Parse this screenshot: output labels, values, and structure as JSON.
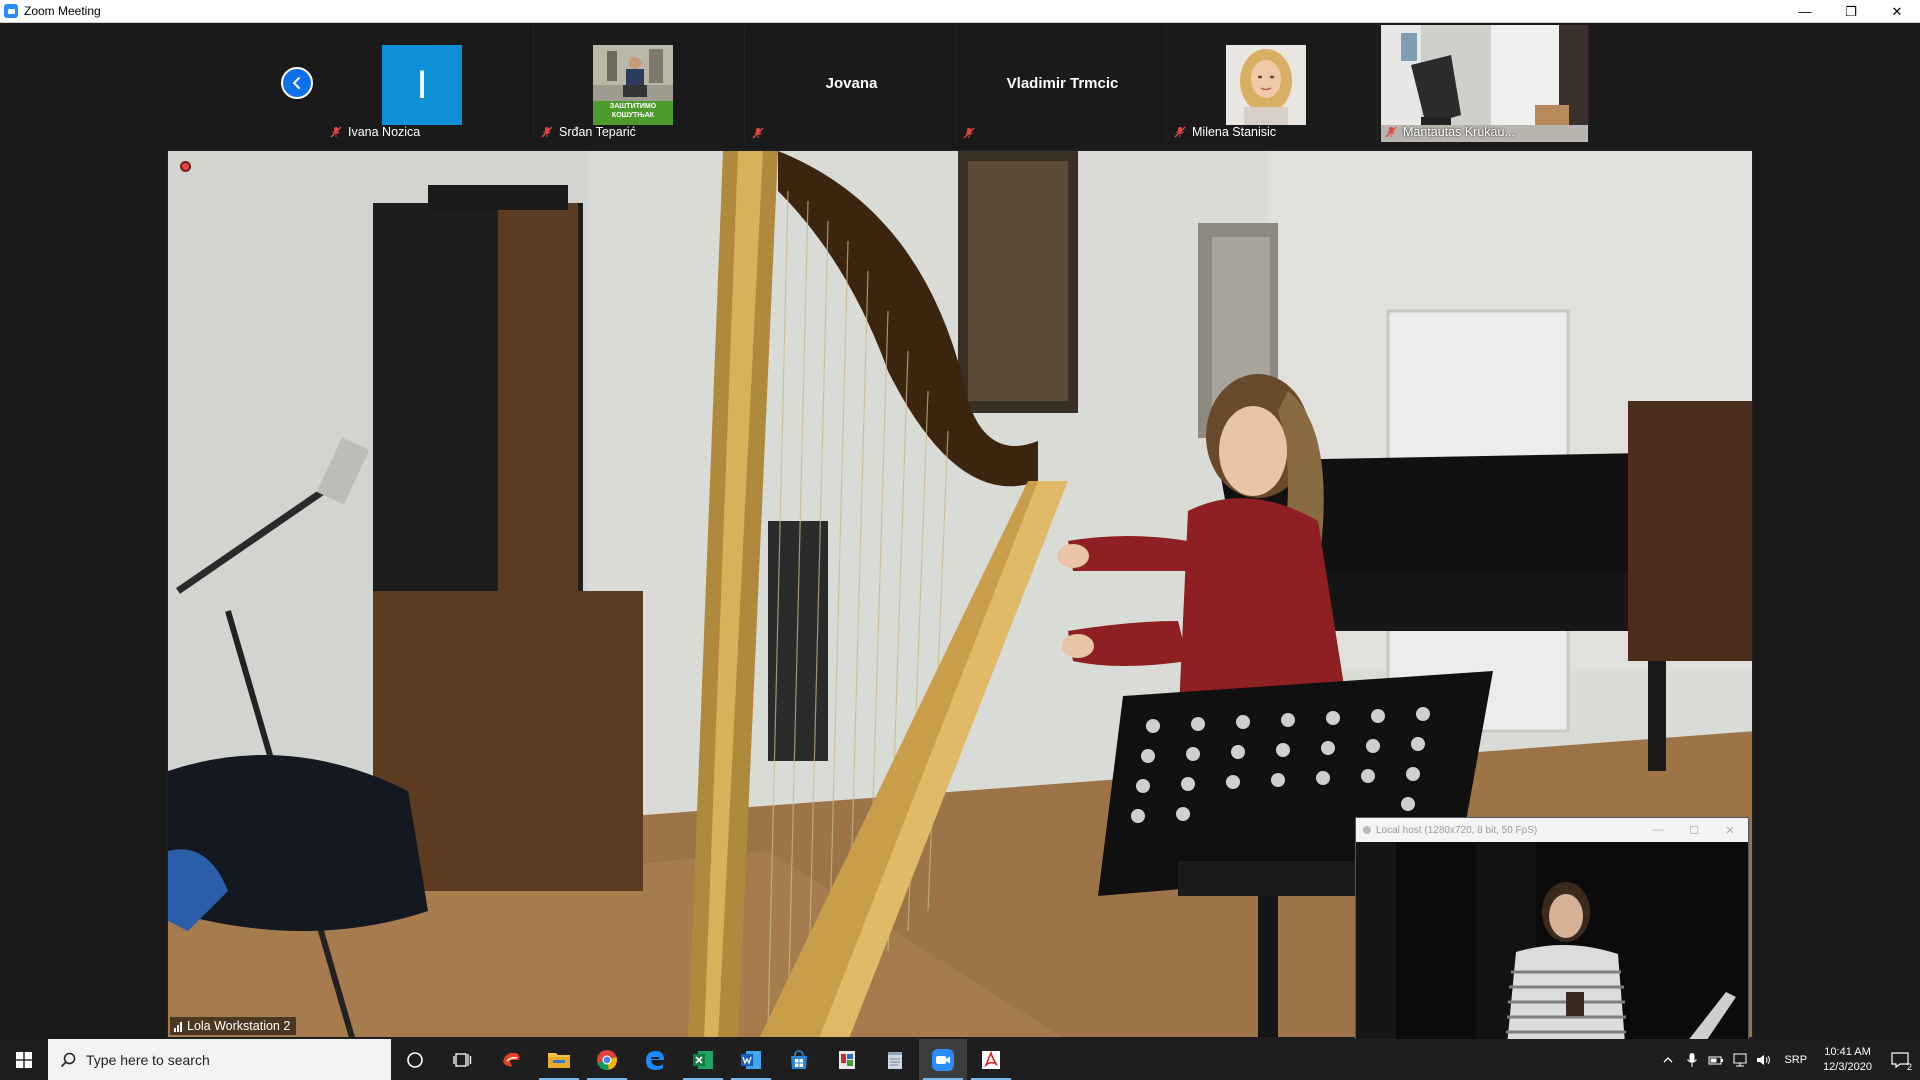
{
  "window": {
    "title": "Zoom Meeting",
    "minimize_glyph": "—",
    "restore_glyph": "❐",
    "close_glyph": "✕"
  },
  "thumbnails": [
    {
      "name": "Ivana Nozica",
      "type": "initial",
      "initial": "I",
      "muted": true
    },
    {
      "name": "Srđan Teparić",
      "type": "photo",
      "photo_text": "ЗАШТИТИМО КОШУТЊАК",
      "muted": true
    },
    {
      "name": "Jovana",
      "type": "name-only",
      "muted": true
    },
    {
      "name": "Vladimir Trmcic",
      "type": "name-only",
      "muted": true
    },
    {
      "name": "Milena Stanisic",
      "type": "photo",
      "muted": true
    },
    {
      "name": "Mantautas Krukau...",
      "type": "photo",
      "muted": true
    }
  ],
  "main_video": {
    "speaker": "Lola Workstation 2"
  },
  "local_preview": {
    "title": "Local host (1280x720, 8 bit, 50 FpS)"
  },
  "taskbar": {
    "search_placeholder": "Type here to search",
    "apps": [
      "cortana-icon",
      "task-view-icon",
      "app-red-icon",
      "file-explorer-icon",
      "chrome-icon",
      "edge-icon",
      "excel-icon",
      "word-icon",
      "store-icon",
      "photo-app-icon",
      "notepad-icon",
      "zoom-icon",
      "acrobat-icon"
    ],
    "language": "SRP",
    "time": "10:41 AM",
    "date": "12/3/2020",
    "notifications": "2"
  },
  "colors": {
    "zoom_blue": "#2d8cff",
    "initial_tile": "#0e8fd6",
    "muted_red": "#e34545"
  }
}
